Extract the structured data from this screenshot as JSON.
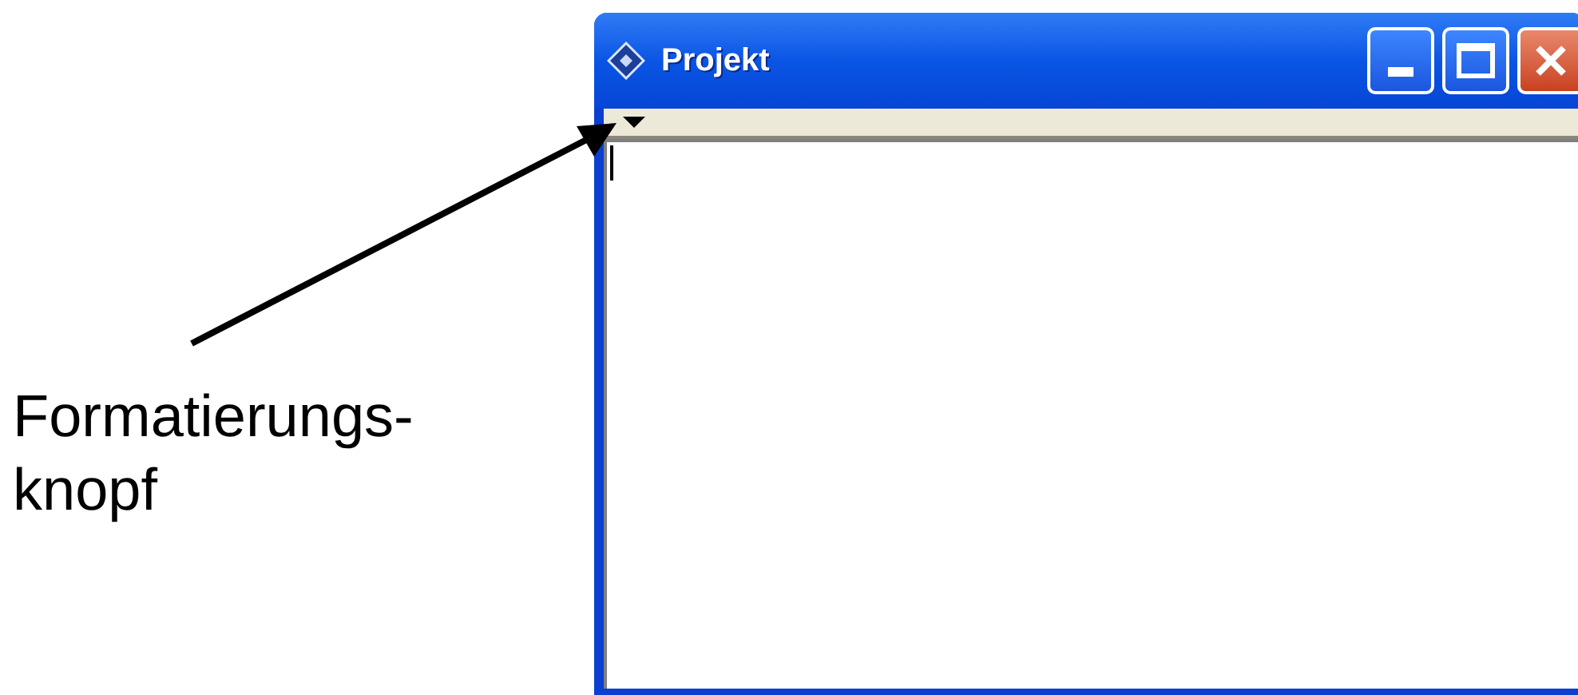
{
  "window": {
    "title": "Projekt"
  },
  "annotation": {
    "lines": [
      "Formatierungs-",
      "knopf"
    ]
  }
}
